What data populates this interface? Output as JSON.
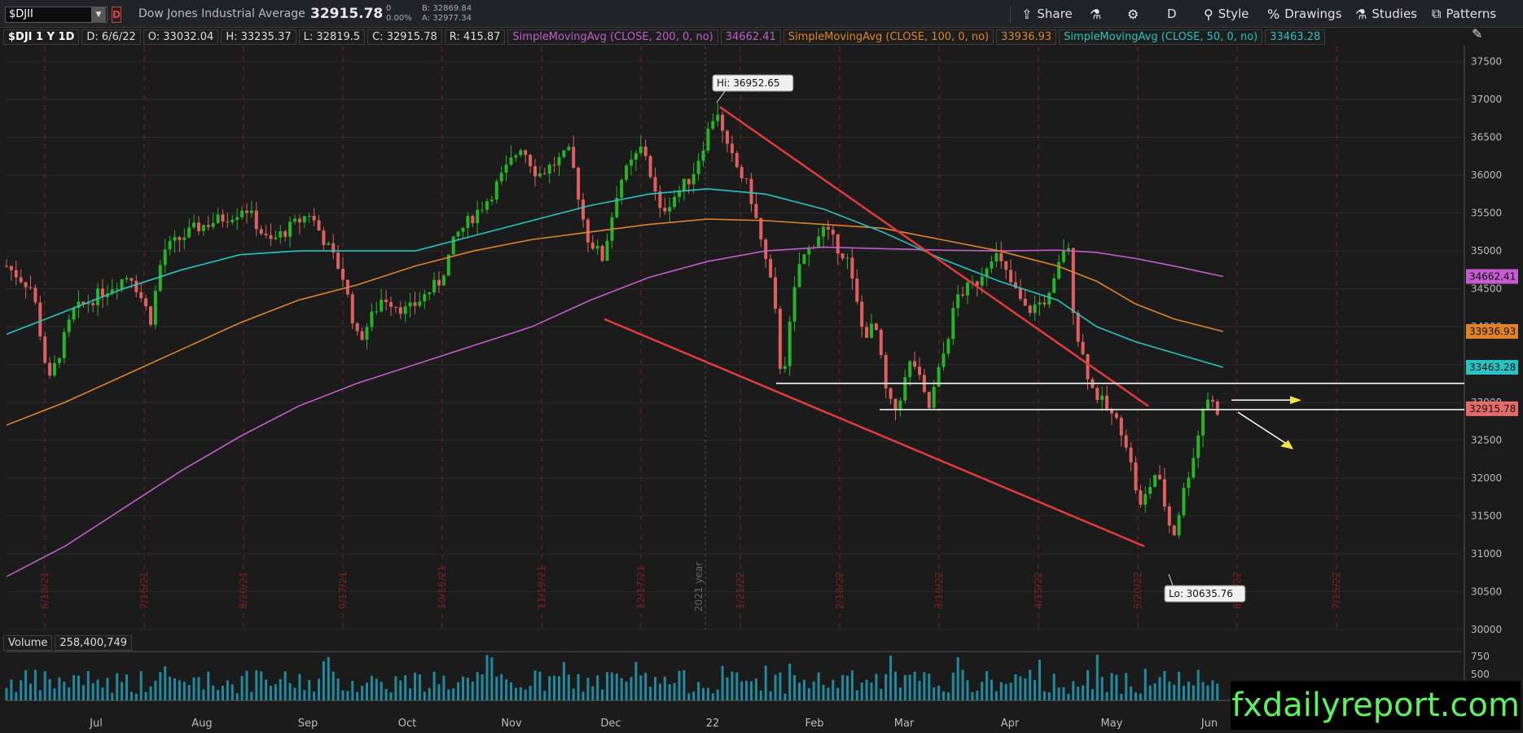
{
  "topbar": {
    "symbol": "$DJII",
    "instrument_name": "Dow Jones Industrial Average",
    "last_price": "32915.78",
    "change": "0",
    "change_pct": "0.00%",
    "bid": "B: 32869.84",
    "ask": "A: 32977.34",
    "share_label": "Share",
    "aggregation_label": "D",
    "style_label": "Style",
    "drawings_label": "Drawings",
    "studies_label": "Studies",
    "patterns_label": "Patterns"
  },
  "infobar": {
    "symbol_period": "$DJI 1 Y 1D",
    "date": "D: 6/6/22",
    "open": "O: 33032.04",
    "high": "H: 33235.37",
    "low": "L: 32819.5",
    "close": "C: 32915.78",
    "range": "R: 415.87",
    "sma200_label": "SimpleMovingAvg (CLOSE, 200, 0, no)",
    "sma200_value": "34662.41",
    "sma100_label": "SimpleMovingAvg (CLOSE, 100, 0, no)",
    "sma100_value": "33936.93",
    "sma50_label": "SimpleMovingAvg (CLOSE, 50, 0, no)",
    "sma50_value": "33463.28"
  },
  "volume_header": {
    "label": "Volume",
    "value": "258,400,749"
  },
  "watermark": "fxdailyreport.com",
  "colors": {
    "sma200": "#c45ccf",
    "sma100": "#e0822a",
    "sma50": "#27c3c3",
    "up": "#27b327",
    "down": "#e06060",
    "trendline": "#e33a3a",
    "volume": "#1f8aa0",
    "price_label": "#e56b6b"
  },
  "chart_data": {
    "type": "candlestick",
    "title": "",
    "y_ticks": [
      37500,
      37000,
      36500,
      36000,
      35500,
      35000,
      34500,
      34000,
      33500,
      33000,
      32500,
      32000,
      31500,
      31000,
      30500,
      30000
    ],
    "y_range": [
      30000,
      37700
    ],
    "x_month_labels": [
      "Jul",
      "Aug",
      "Sep",
      "Oct",
      "Nov",
      "Dec",
      "22",
      "Feb",
      "Mar",
      "Apr",
      "May",
      "Jun"
    ],
    "x_date_labels": [
      "6/18/21",
      "7/16/21",
      "8/20/21",
      "9/17/21",
      "10/15/21",
      "11/19/21",
      "12/17/21",
      "1/21/22",
      "2/18/22",
      "3/18/22",
      "4/15/22",
      "5/20/22",
      "6/17/22",
      "7/15/22"
    ],
    "year_marker": "2021 year",
    "annotations": {
      "high": {
        "label": "Hi: 36952.65",
        "value": 36952.65
      },
      "low": {
        "label": "Lo: 30635.76",
        "value": 30635.76
      }
    },
    "price_labels": {
      "sma200": "34662.41",
      "sma100": "33936.93",
      "sma50": "33463.28",
      "last": "32915.78"
    },
    "horizontal_levels": [
      33251,
      32905
    ],
    "volume_ticks": [
      "750",
      "500"
    ],
    "sma200_points": [
      [
        0,
        30700
      ],
      [
        60,
        31100
      ],
      [
        120,
        31600
      ],
      [
        180,
        32100
      ],
      [
        240,
        32550
      ],
      [
        300,
        32950
      ],
      [
        360,
        33250
      ],
      [
        420,
        33500
      ],
      [
        480,
        33750
      ],
      [
        540,
        34000
      ],
      [
        600,
        34350
      ],
      [
        660,
        34650
      ],
      [
        720,
        34860
      ],
      [
        780,
        35000
      ],
      [
        840,
        35050
      ],
      [
        900,
        35030
      ],
      [
        960,
        35010
      ],
      [
        1020,
        35000
      ],
      [
        1080,
        35010
      ],
      [
        1120,
        34980
      ],
      [
        1160,
        34900
      ],
      [
        1200,
        34800
      ],
      [
        1250,
        34662
      ]
    ],
    "sma100_points": [
      [
        0,
        32700
      ],
      [
        60,
        33000
      ],
      [
        120,
        33350
      ],
      [
        180,
        33700
      ],
      [
        240,
        34050
      ],
      [
        300,
        34350
      ],
      [
        360,
        34550
      ],
      [
        420,
        34800
      ],
      [
        480,
        35000
      ],
      [
        540,
        35150
      ],
      [
        600,
        35250
      ],
      [
        660,
        35350
      ],
      [
        720,
        35420
      ],
      [
        780,
        35400
      ],
      [
        840,
        35350
      ],
      [
        900,
        35300
      ],
      [
        960,
        35150
      ],
      [
        1020,
        35000
      ],
      [
        1080,
        34800
      ],
      [
        1120,
        34600
      ],
      [
        1160,
        34300
      ],
      [
        1200,
        34100
      ],
      [
        1250,
        33936
      ]
    ],
    "sma50_points": [
      [
        0,
        33900
      ],
      [
        60,
        34200
      ],
      [
        120,
        34500
      ],
      [
        180,
        34750
      ],
      [
        240,
        34950
      ],
      [
        300,
        35000
      ],
      [
        360,
        35000
      ],
      [
        420,
        35000
      ],
      [
        480,
        35200
      ],
      [
        540,
        35400
      ],
      [
        600,
        35600
      ],
      [
        660,
        35750
      ],
      [
        720,
        35820
      ],
      [
        780,
        35750
      ],
      [
        840,
        35550
      ],
      [
        900,
        35250
      ],
      [
        960,
        34900
      ],
      [
        1020,
        34600
      ],
      [
        1080,
        34350
      ],
      [
        1120,
        34000
      ],
      [
        1160,
        33800
      ],
      [
        1200,
        33650
      ],
      [
        1250,
        33463
      ]
    ],
    "candles_approx": "synthetic daily candles along trend; visual approximation"
  }
}
